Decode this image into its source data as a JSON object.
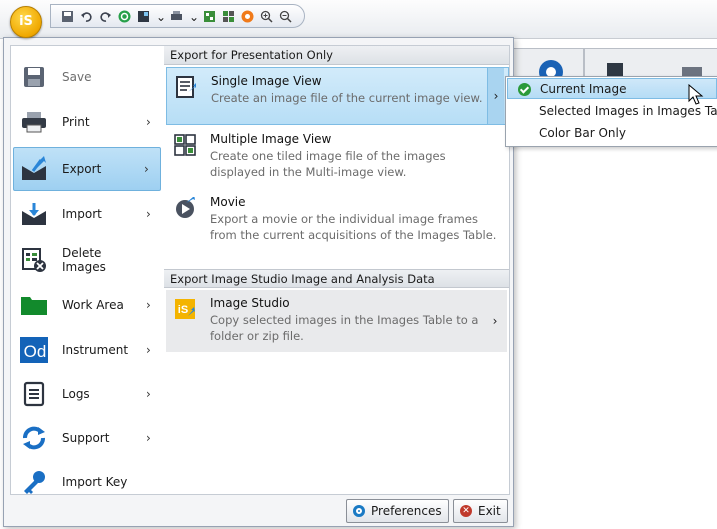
{
  "quick_access": {
    "icons": [
      "save-icon",
      "undo-icon",
      "redo-icon",
      "refresh-icon",
      "image-icon",
      "dropdown-icon",
      "print-icon",
      "dropdown-icon",
      "grid-icon",
      "table-icon",
      "record-icon",
      "zoom-in-icon",
      "zoom-out-icon"
    ]
  },
  "app_button": {
    "label": "iS"
  },
  "left_menu": {
    "items": [
      {
        "label": "Save",
        "icon": "save-icon",
        "enabled": false,
        "has_submenu": false
      },
      {
        "label": "Print",
        "icon": "print-icon",
        "enabled": true,
        "has_submenu": true
      },
      {
        "label": "Export",
        "icon": "export-icon",
        "enabled": true,
        "has_submenu": true,
        "selected": true
      },
      {
        "label": "Import",
        "icon": "import-icon",
        "enabled": true,
        "has_submenu": true
      },
      {
        "label": "Delete Images",
        "icon": "delete-images-icon",
        "enabled": true,
        "has_submenu": false
      },
      {
        "label": "Work Area",
        "icon": "folder-icon",
        "enabled": true,
        "has_submenu": true
      },
      {
        "label": "Instrument",
        "icon": "instrument-icon",
        "enabled": true,
        "has_submenu": true
      },
      {
        "label": "Logs",
        "icon": "logs-icon",
        "enabled": true,
        "has_submenu": true
      },
      {
        "label": "Support",
        "icon": "support-icon",
        "enabled": true,
        "has_submenu": true
      },
      {
        "label": "Import Key",
        "icon": "key-icon",
        "enabled": true,
        "has_submenu": false
      }
    ],
    "arrow": "›"
  },
  "export_panel": {
    "section1": "Export for Presentation Only",
    "section2": "Export Image Studio Image and Analysis Data",
    "items": [
      {
        "title": "Single Image View",
        "desc": "Create an image file of the current image view.",
        "icon": "single-image-icon"
      },
      {
        "title": "Multiple Image View",
        "desc": "Create one tiled image file of the images displayed in the Multi-image view.",
        "icon": "multi-image-icon"
      },
      {
        "title": "Movie",
        "desc": "Export a movie or the individual image frames from the current acquisitions of the Images Table.",
        "icon": "movie-icon"
      },
      {
        "title": "Image Studio",
        "desc": "Copy selected images in the Images Table to a folder or zip file.",
        "icon": "image-studio-icon"
      }
    ]
  },
  "submenu": {
    "items": [
      {
        "label": "Current Image",
        "checked": true
      },
      {
        "label": "Selected Images in Images Table",
        "checked": false
      },
      {
        "label": "Color Bar Only",
        "checked": false
      }
    ]
  },
  "footer": {
    "preferences_label": "Preferences",
    "exit_label": "Exit"
  },
  "colors": {
    "selection": "#b7def6",
    "accent": "#1a7ac4",
    "app_button": "#f0a800",
    "exit_icon": "#c0392b",
    "check": "#2b9a3a"
  }
}
